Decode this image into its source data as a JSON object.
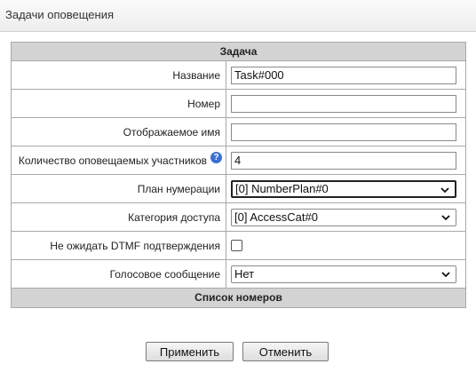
{
  "window": {
    "title": "Задачи оповещения"
  },
  "section": {
    "title": "Задача",
    "numbers_title": "Список номеров"
  },
  "fields": {
    "name": {
      "label": "Название",
      "value": "Task#000"
    },
    "number": {
      "label": "Номер",
      "value": ""
    },
    "display_name": {
      "label": "Отображаемое имя",
      "value": ""
    },
    "participants": {
      "label": "Количество оповещаемых участников",
      "value": "4"
    },
    "numbering_plan": {
      "label": "План нумерации",
      "value": "[0] NumberPlan#0"
    },
    "access_category": {
      "label": "Категория доступа",
      "value": "[0] AccessCat#0"
    },
    "no_dtmf": {
      "label": "Не ожидать DTMF подтверждения",
      "checked": false
    },
    "voice_message": {
      "label": "Голосовое сообщение",
      "value": "Нет"
    }
  },
  "buttons": {
    "apply": "Применить",
    "cancel": "Отменить"
  },
  "icons": {
    "help": "help-icon",
    "chevron": "chevron-down-icon"
  },
  "colors": {
    "accent": "#3b6fd0",
    "header_bg": "#d3d3d3"
  }
}
